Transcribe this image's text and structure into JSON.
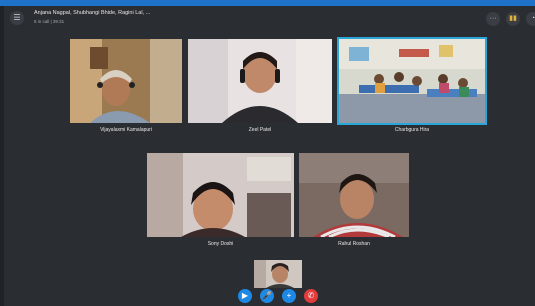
{
  "window": {
    "title": "Anjana Nagpal, Shubhangi Bhide, Ragini Lal, ...",
    "subtitle": "5 in call | 39:31"
  },
  "header": {
    "call_icon": "call-group-icon",
    "more_label": "···",
    "signal_label": "▮▮",
    "chat_label": "◔"
  },
  "participants": [
    {
      "name": "Vijayalaxmi Kamalapuri"
    },
    {
      "name": "Zeel Patel"
    },
    {
      "name": "Charbgura Hira"
    },
    {
      "name": "Sony Doshi"
    },
    {
      "name": "Rahul  Roshan"
    }
  ],
  "controls": {
    "video_label": "▶",
    "mic_label": "🎤",
    "add_label": "+",
    "end_label": "✆"
  },
  "colors": {
    "accent": "#2aa6d9",
    "end_call": "#e23b3b",
    "control_blue": "#1e88e5"
  }
}
